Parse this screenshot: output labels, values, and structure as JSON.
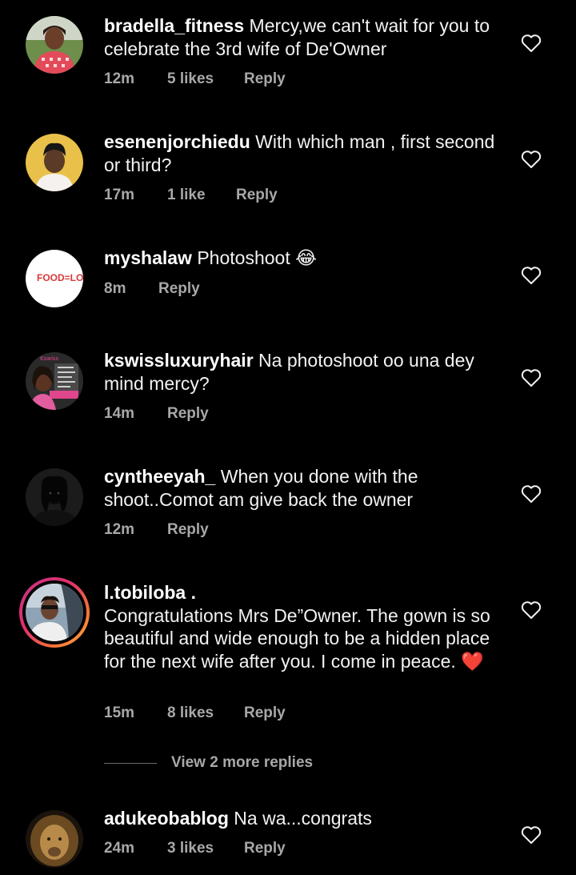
{
  "comments": [
    {
      "username": "bradella_fitness",
      "text": "Mercy,we can't wait for you to celebrate the 3rd wife of De'Owner",
      "time": "12m",
      "likes": "5 likes",
      "reply": "Reply",
      "avatar_icon": "avatar-woman-pink-checkered"
    },
    {
      "username": "esenenjorchiedu",
      "text": "With which man , first second or third?",
      "time": "17m",
      "likes": "1 like",
      "reply": "Reply",
      "avatar_icon": "avatar-person-yellow-bg"
    },
    {
      "username": "myshalaw",
      "text": "Photoshoot 😂",
      "time": "8m",
      "likes": "",
      "reply": "Reply",
      "avatar_text": "FOOD=LO"
    },
    {
      "username": "kswissluxuryhair",
      "text": "Na photoshoot oo una dey mind mercy?",
      "time": "14m",
      "likes": "",
      "reply": "Reply",
      "avatar_icon": "avatar-hair-shop-flyer"
    },
    {
      "username": "cyntheeyah_",
      "text": "When you done with the shoot..Comot am give back the owner",
      "time": "12m",
      "likes": "",
      "reply": "Reply",
      "avatar_icon": "avatar-dark-portrait"
    },
    {
      "username": "l.tobiloba",
      "username_suffix": ".",
      "text": "Congratulations Mrs De”Owner. The gown is so beautiful and wide enough to be a hidden place for the next wife after you. I come in peace. ❤️",
      "time": "15m",
      "likes": "8 likes",
      "reply": "Reply",
      "avatar_icon": "avatar-man-in-car-story-ring"
    },
    {
      "username": "adukeobablog",
      "text": "Na wa...congrats",
      "time": "24m",
      "likes": "3 likes",
      "reply": "Reply",
      "avatar_icon": "avatar-lion"
    }
  ],
  "view_more_replies": "View 2 more replies",
  "icons": {
    "like": "heart-outline-icon"
  },
  "colors": {
    "background": "#000000",
    "text": "#f2f2f2",
    "meta": "#a8a8a8"
  }
}
